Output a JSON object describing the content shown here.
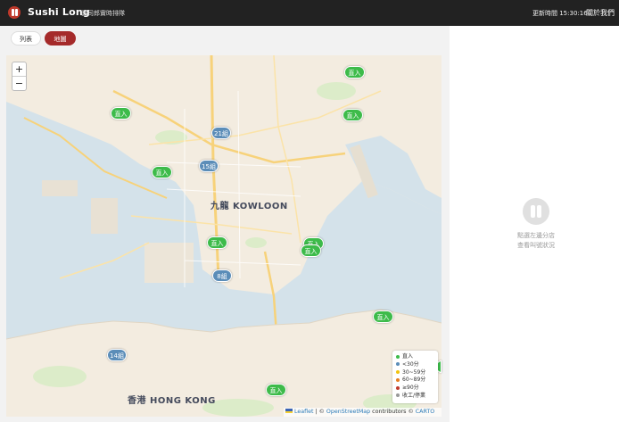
{
  "header": {
    "brand": "Sushi Long",
    "tagline": "壽司郎實時排隊",
    "updated": "更新時間 15:30:16",
    "about": "關於我們"
  },
  "view_toggle": {
    "list_label": "列表",
    "map_label": "地圖",
    "selected": "地圖"
  },
  "map": {
    "zoom_in": "+",
    "zoom_out": "−",
    "labels": {
      "kowloon": "九龍 KOWLOON",
      "hongkong": "香港 HONG KONG"
    },
    "markers": [
      "直入",
      "直入",
      "直入",
      "21組",
      "15組",
      "直入",
      "直入",
      "直入",
      "直入",
      "8組",
      "直入",
      "14組",
      "直入",
      "直入"
    ],
    "legend": [
      {
        "label": "直入",
        "color": "#3dbb4a"
      },
      {
        "label": "<30分",
        "color": "#5b8db8"
      },
      {
        "label": "30~59分",
        "color": "#f1c40f"
      },
      {
        "label": "60~89分",
        "color": "#e67e22"
      },
      {
        "label": "≥90分",
        "color": "#c0392b"
      },
      {
        "label": "收工/停業",
        "color": "#999999"
      }
    ],
    "attribution": {
      "leaflet": "Leaflet",
      "sep": "| ©",
      "osm": "OpenStreetMap",
      "contrib": "contributors ©",
      "carto": "CARTO"
    }
  },
  "empty_state": {
    "line1": "點選左邊分店",
    "line2": "查看叫號狀況"
  },
  "colors": {
    "accent": "#a52a2a",
    "header_bg": "#222222",
    "water": "#d4e2ea",
    "land": "#f3ece0"
  }
}
